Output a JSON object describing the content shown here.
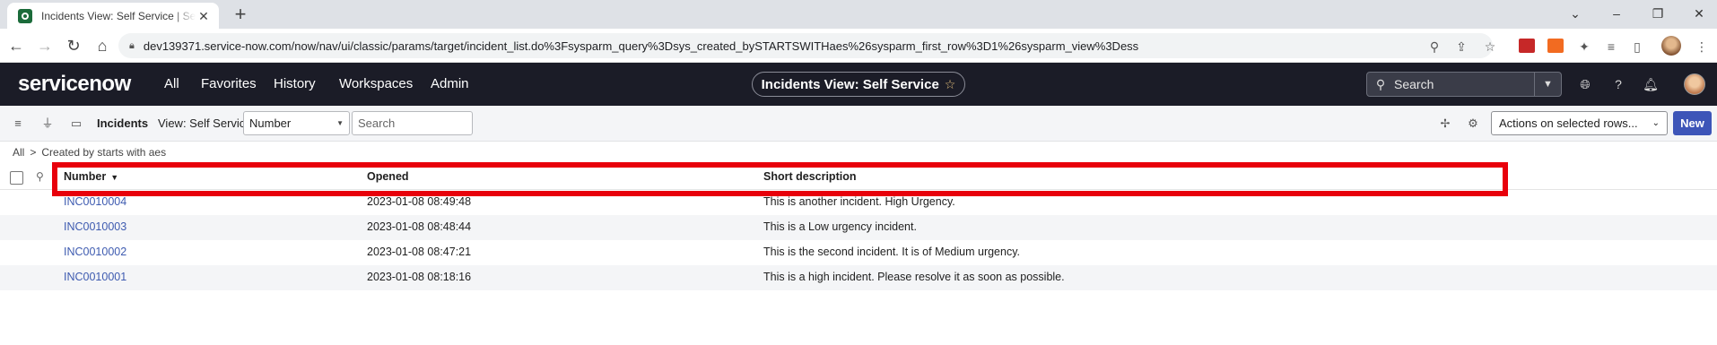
{
  "browser": {
    "tab_title": "Incidents View: Self Service | ServiceNow",
    "url": "dev139371.service-now.com/now/nav/ui/classic/params/target/incident_list.do%3Fsysparm_query%3Dsys_created_bySTARTSWITHaes%26sysparm_first_row%3D1%26sysparm_view%3Dess"
  },
  "header": {
    "logo": "servicenow",
    "nav": [
      "All",
      "Favorites",
      "History",
      "Workspaces",
      "Admin"
    ],
    "context_title": "Incidents View: Self Service",
    "search_placeholder": "Search"
  },
  "listbar": {
    "title": "Incidents",
    "view_label": "View: Self Service",
    "field_select": "Number",
    "search_placeholder": "Search",
    "actions_label": "Actions on selected rows...",
    "new_label": "New"
  },
  "breadcrumb": {
    "root": "All",
    "separator": ">",
    "filter": "Created by starts with aes"
  },
  "table": {
    "columns": [
      "Number",
      "Opened",
      "Short description"
    ],
    "rows": [
      {
        "number": "INC0010004",
        "opened": "2023-01-08 08:49:48",
        "description": "This is another incident. High Urgency."
      },
      {
        "number": "INC0010003",
        "opened": "2023-01-08 08:48:44",
        "description": "This is a Low urgency incident."
      },
      {
        "number": "INC0010002",
        "opened": "2023-01-08 08:47:21",
        "description": "This is the second incident. It is of Medium urgency."
      },
      {
        "number": "INC0010001",
        "opened": "2023-01-08 08:18:16",
        "description": "This is a high incident. Please resolve it as soon as possible."
      }
    ]
  },
  "colors": {
    "header_bg": "#1b1c27",
    "link": "#3e5bb0",
    "primary_button": "#3d55b8",
    "highlight": "#e8000b"
  }
}
